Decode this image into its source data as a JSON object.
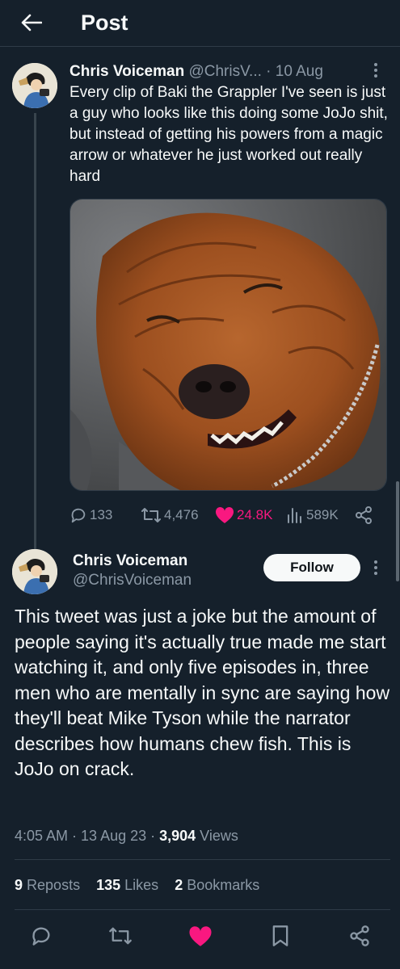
{
  "header": {
    "title": "Post"
  },
  "tweet": {
    "author_name": "Chris Voiceman",
    "author_handle": "@ChrisV...",
    "date": "· 10 Aug",
    "text": "Every clip of Baki the Grappler I've seen is just a guy who looks like this doing some JoJo shit, but instead of getting his powers from a magic arrow or whatever he just worked out really hard",
    "image_icon": "grinning-dog-photo",
    "replies": "133",
    "reposts": "4,476",
    "likes": "24.8K",
    "views": "589K"
  },
  "reply": {
    "author_name": "Chris Voiceman",
    "author_handle": "@ChrisVoiceman",
    "follow_label": "Follow",
    "text": "This tweet was just a joke but the amount of people saying it's actually true made me start watching it, and only five episodes in, three men who are mentally in sync are saying how they'll beat Mike Tyson while the narrator describes how humans chew fish. This is JoJo on crack.",
    "time": "4:05 AM · 13 Aug 23 · ",
    "views_count": "3,904",
    "views_label": " Views",
    "reposts_count": "9",
    "reposts_label": "Reposts",
    "likes_count": "135",
    "likes_label": "Likes",
    "bookmarks_count": "2",
    "bookmarks_label": "Bookmarks"
  },
  "colors": {
    "background": "#15202b",
    "text": "#f7f9f9",
    "muted": "#8b98a5",
    "like": "#f91880"
  }
}
